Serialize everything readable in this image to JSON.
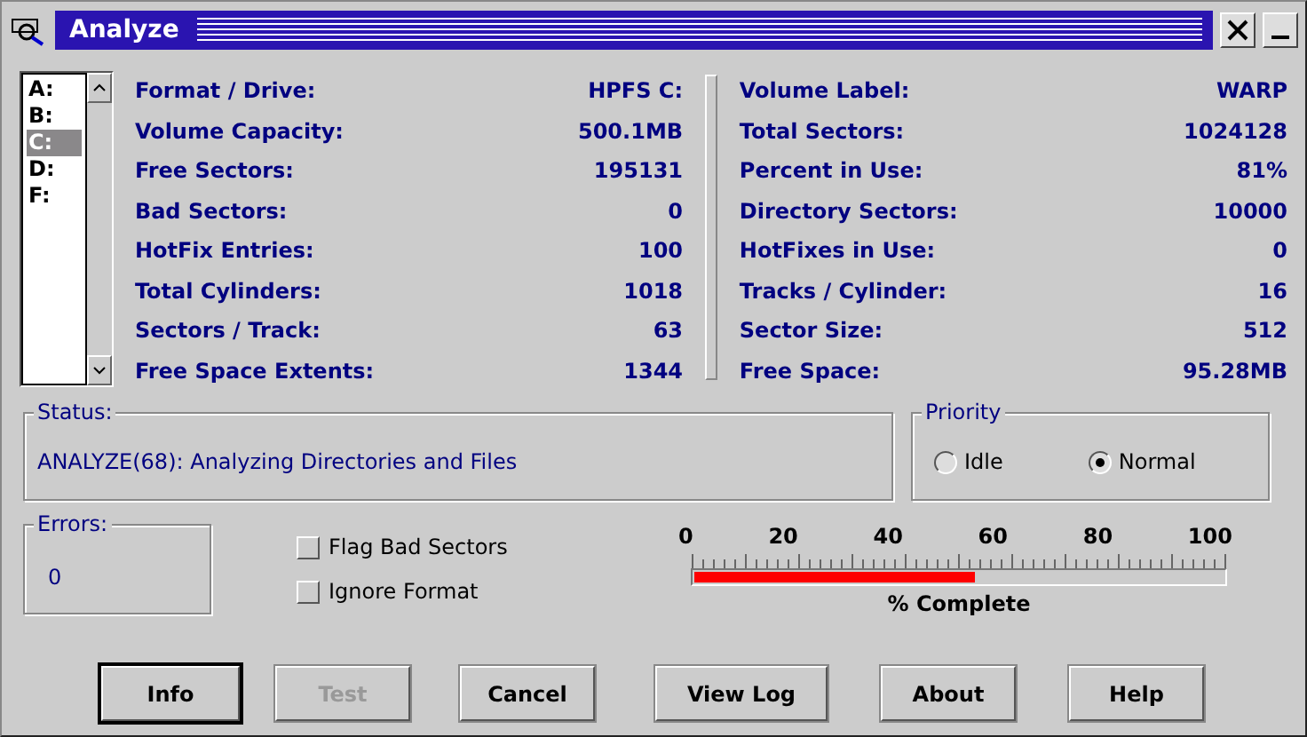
{
  "window": {
    "title": "Analyze"
  },
  "drives": [
    {
      "label": "A:",
      "selected": false
    },
    {
      "label": "B:",
      "selected": false
    },
    {
      "label": "C:",
      "selected": true
    },
    {
      "label": "D:",
      "selected": false
    },
    {
      "label": "F:",
      "selected": false
    }
  ],
  "left_fields": [
    {
      "label": "Format / Drive:",
      "value": "HPFS C:"
    },
    {
      "label": "Volume Capacity:",
      "value": "500.1MB"
    },
    {
      "label": "Free Sectors:",
      "value": "195131"
    },
    {
      "label": "Bad Sectors:",
      "value": "0"
    },
    {
      "label": "HotFix Entries:",
      "value": "100"
    },
    {
      "label": "Total Cylinders:",
      "value": "1018"
    },
    {
      "label": "Sectors / Track:",
      "value": "63"
    },
    {
      "label": "Free Space Extents:",
      "value": "1344"
    }
  ],
  "right_fields": [
    {
      "label": "Volume Label:",
      "value": "WARP"
    },
    {
      "label": "Total Sectors:",
      "value": "1024128"
    },
    {
      "label": "Percent in Use:",
      "value": "81%"
    },
    {
      "label": "Directory Sectors:",
      "value": "10000"
    },
    {
      "label": "HotFixes in Use:",
      "value": "0"
    },
    {
      "label": "Tracks / Cylinder:",
      "value": "16"
    },
    {
      "label": "Sector Size:",
      "value": "512"
    },
    {
      "label": "Free Space:",
      "value": "95.28MB"
    }
  ],
  "status": {
    "title": "Status:",
    "text": "ANALYZE(68): Analyzing Directories and Files"
  },
  "priority": {
    "title": "Priority",
    "options": [
      {
        "label": "Idle",
        "selected": false
      },
      {
        "label": "Normal",
        "selected": true
      }
    ]
  },
  "errors": {
    "title": "Errors:",
    "value": "0"
  },
  "options": [
    {
      "label": "Flag Bad Sectors",
      "checked": false
    },
    {
      "label": "Ignore Format",
      "checked": false
    }
  ],
  "progress": {
    "ticks": [
      "0",
      "20",
      "40",
      "60",
      "80",
      "100"
    ],
    "level": 0.53,
    "label": "% Complete"
  },
  "buttons": [
    {
      "label": "Info",
      "default": true,
      "disabled": false
    },
    {
      "label": "Test",
      "default": false,
      "disabled": true
    },
    {
      "label": "Cancel",
      "default": false,
      "disabled": false
    },
    {
      "label": "View Log",
      "default": false,
      "disabled": false
    },
    {
      "label": "About",
      "default": false,
      "disabled": false
    },
    {
      "label": "Help",
      "default": false,
      "disabled": false
    }
  ]
}
